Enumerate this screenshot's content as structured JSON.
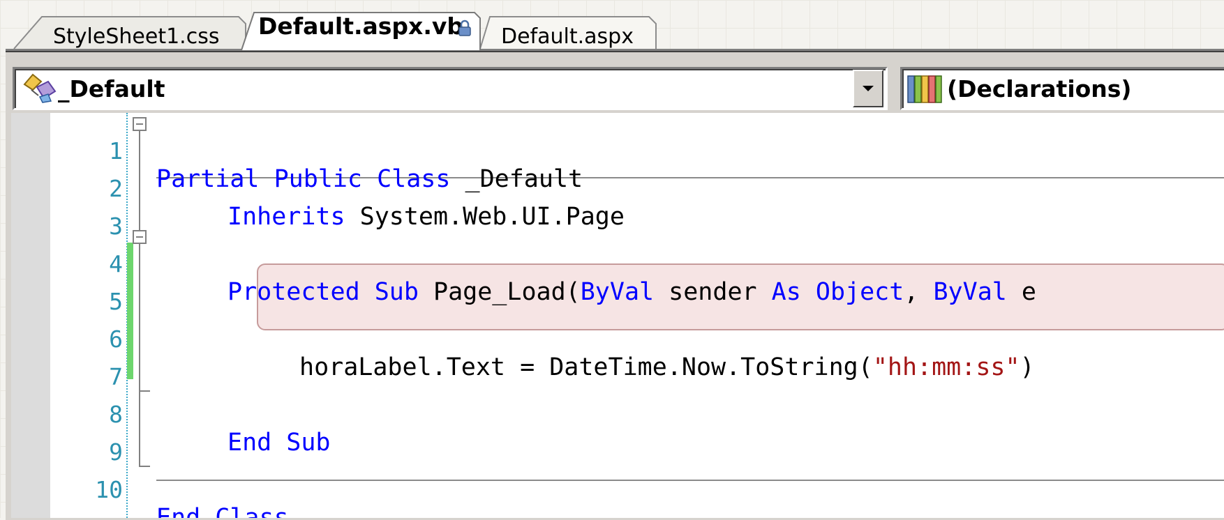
{
  "tabs": [
    {
      "label": "StyleSheet1.css",
      "active": false
    },
    {
      "label": "Default.aspx.vb",
      "active": true,
      "locked": true
    },
    {
      "label": "Default.aspx",
      "active": false
    }
  ],
  "navbar": {
    "class_combo": {
      "value": "_Default",
      "icon": "class-members-icon"
    },
    "member_combo": {
      "value": "(Declarations)",
      "icon": "declarations-icon"
    }
  },
  "editor": {
    "lines": [
      {
        "num": "1"
      },
      {
        "num": "2"
      },
      {
        "num": "3"
      },
      {
        "num": "4"
      },
      {
        "num": "5"
      },
      {
        "num": "6"
      },
      {
        "num": "7"
      },
      {
        "num": "8"
      },
      {
        "num": "9"
      },
      {
        "num": "10"
      }
    ],
    "tokens": {
      "l1_kw": "Partial Public Class",
      "l1_rest": " _Default",
      "l2_kw": "Inherits",
      "l2_rest": " System.Web.UI.Page",
      "l4_kw1": "Protected Sub",
      "l4_t1": " Page_Load(",
      "l4_kw2": "ByVal",
      "l4_t2": " sender ",
      "l4_kw3": "As Object",
      "l4_t3": ", ",
      "l4_kw4": "ByVal",
      "l4_t4": " e",
      "l6_t1": "horaLabel.Text = DateTime.Now.ToString(",
      "l6_str": "\"hh:mm:ss\"",
      "l6_t2": ")",
      "l8_kw": "End Sub",
      "l10_kw": "End Class"
    }
  },
  "colors": {
    "keyword": "#0000ff",
    "string": "#a31515",
    "line_number": "#2b91af",
    "change_bar": "#6dd66d",
    "highlight_fill": "#f6e4e4"
  }
}
